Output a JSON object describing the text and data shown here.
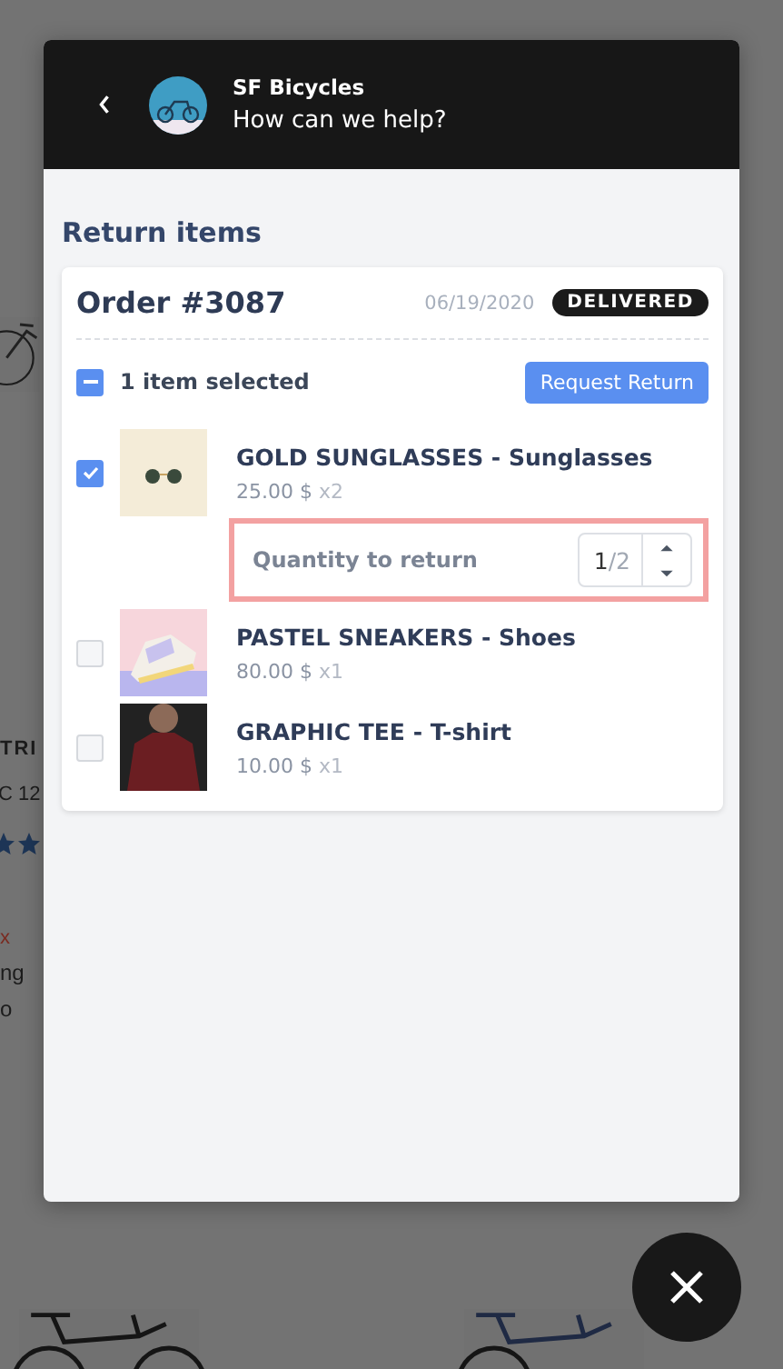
{
  "backdrop": {
    "texts": [
      "TRI",
      "C 12",
      "x",
      "ng",
      "o"
    ]
  },
  "chat": {
    "title": "SF Bicycles",
    "subtitle": "How can we help?"
  },
  "section_title": "Return items",
  "order": {
    "number": "Order #3087",
    "date": "06/19/2020",
    "status": "DELIVERED",
    "selection": {
      "label": "1 item selected",
      "indeterminate": true
    },
    "action": "Request Return",
    "items": [
      {
        "name": "GOLD SUNGLASSES - Sunglasses",
        "price": "25.00 $",
        "qty": "x2",
        "checked": true,
        "kind": "sunglasses",
        "quantity": {
          "label": "Quantity to return",
          "value": "1",
          "max": "/2",
          "highlighted": true
        }
      },
      {
        "name": "PASTEL SNEAKERS - Shoes",
        "price": "80.00 $",
        "qty": "x1",
        "checked": false,
        "kind": "sneakers"
      },
      {
        "name": "GRAPHIC TEE - T-shirt",
        "price": "10.00 $",
        "qty": "x1",
        "checked": false,
        "kind": "tee"
      }
    ]
  }
}
